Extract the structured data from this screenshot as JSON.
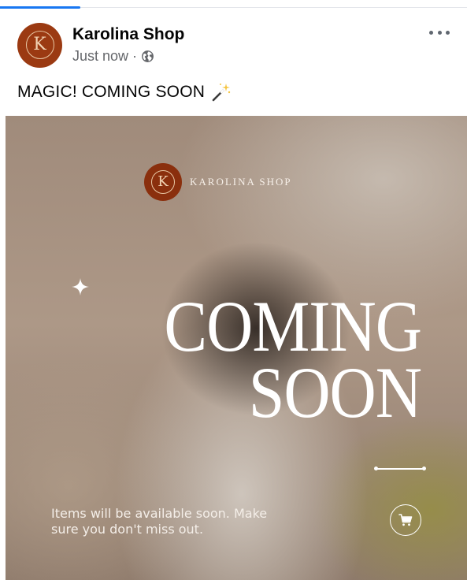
{
  "post": {
    "author": "Karolina Shop",
    "timestamp": "Just now",
    "separator": "·",
    "audience_icon": "globe-icon",
    "more_icon": "more-horizontal-icon",
    "caption": "MAGIC! COMING SOON",
    "caption_emoji_icon": "magic-wand-icon",
    "avatar_letter": "K"
  },
  "image": {
    "brand_letter": "K",
    "brand_name": "KAROLINA SHOP",
    "headline_line1": "COMING",
    "headline_line2": "SOON",
    "tagline": "Items will be available soon. Make sure you don't miss out.",
    "cart_icon": "shopping-cart-icon",
    "sparkle_icon": "sparkle-icon"
  },
  "colors": {
    "accent": "#1877f2",
    "brand": "#9b3a12",
    "text_primary": "#050505",
    "text_secondary": "#65676b"
  }
}
